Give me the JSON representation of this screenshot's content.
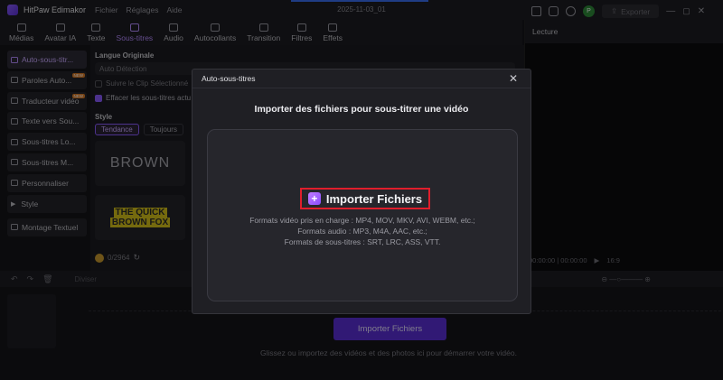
{
  "app": {
    "name": "HitPaw Edimakor",
    "menus": [
      "Fichier",
      "Réglages",
      "Aide"
    ],
    "project": "2025-11-03_01",
    "avatar": "P",
    "export": "Exporter"
  },
  "toolbar": {
    "tabs": [
      "Médias",
      "Avatar IA",
      "Texte",
      "Sous-titres",
      "Audio",
      "Autocollants",
      "Transition",
      "Filtres",
      "Effets"
    ],
    "active": "Sous-titres"
  },
  "sidebar": {
    "items": [
      "Auto-sous-titr...",
      "Paroles Auto...",
      "Traducteur vidéo",
      "Texte vers Sou...",
      "Sous-titres Lo...",
      "Sous-titres M...",
      "Personnaliser",
      "Style",
      "Montage Textuel"
    ],
    "badges": [
      "NEW",
      "NEW"
    ]
  },
  "panel": {
    "lang_label": "Langue Originale",
    "lang_value": "Auto Détection",
    "opt1": "Suivre le Clip Sélectionné",
    "opt2": "Effacer les sous-titres actu",
    "style_label": "Style",
    "chips": [
      "Tendance",
      "Toujours"
    ],
    "sample1": "BROWN",
    "sample2_line1": "THE QUICK",
    "sample2_line2": "BROWN FOX",
    "credits": "0/2964"
  },
  "preview": {
    "title": "Lecture",
    "time": "00:00:00 | 00:00:00",
    "ratio": "16:9"
  },
  "timeline": {
    "tool": "Diviser",
    "import_button": "Importer Fichiers",
    "hint": "Glissez ou importez des vidéos et des photos ici pour démarrer votre vidéo."
  },
  "dialog": {
    "title": "Auto-sous-titres",
    "subtitle": "Importer des fichiers pour sous-titrer une vidéo",
    "import_label": "Importer Fichiers",
    "formats": [
      "Formats vidéo pris en charge : MP4, MOV, MKV, AVI, WEBM, etc.;",
      "Formats audio : MP3, M4A, AAC, etc.;",
      "Formats de sous-titres : SRT, LRC, ASS, VTT."
    ],
    "close": "✕"
  },
  "colors": {
    "accent": "#8a5cff",
    "highlight": "#e01e2c",
    "bg": "#141418"
  }
}
